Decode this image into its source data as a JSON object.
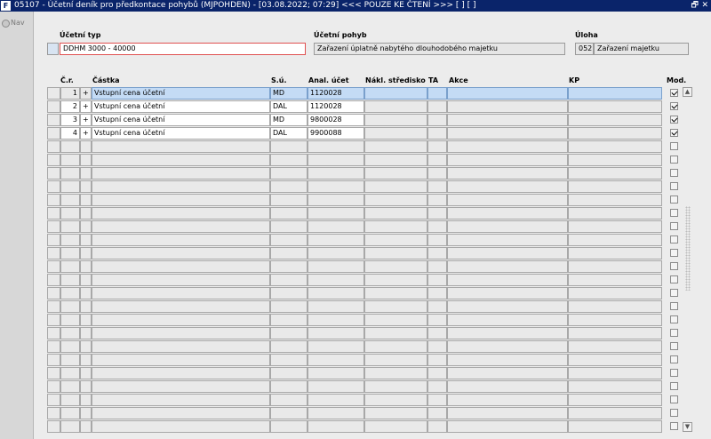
{
  "window": {
    "app_icon_label": "F",
    "title": "05107 - Účetní deník pro předkontace pohybů (MJPOHDEN) - [03.08.2022; 07:29] <<< POUZE KE ČTENÍ >>>  [ ] [ ]",
    "restore_glyph": "🗗",
    "close_glyph": "✕"
  },
  "nav": {
    "label": "Nav"
  },
  "header": {
    "typ_label": "Účetní typ",
    "typ_value": "DDHM 3000 - 40000",
    "pohyb_label": "Účetní pohyb",
    "pohyb_value": "Zařazení úplatně nabytého dlouhodobého majetku",
    "uloha_label": "Úloha",
    "uloha_code": "052",
    "uloha_value": "Zařazení majetku"
  },
  "columns": {
    "cr": "Č.r.",
    "castka": "Částka",
    "su": "S.ú.",
    "anal": "Anal. účet",
    "nakl": "Nákl. středisko",
    "ta": "TA",
    "akce": "Akce",
    "kp": "KP",
    "mod": "Mod."
  },
  "rows": [
    {
      "cr": "1",
      "sign": "+",
      "castka": "Vstupní cena účetní",
      "su": "MD",
      "anal": "1120028",
      "mod": true
    },
    {
      "cr": "2",
      "sign": "+",
      "castka": "Vstupní cena účetní",
      "su": "DAL",
      "anal": "1120028",
      "mod": true
    },
    {
      "cr": "3",
      "sign": "+",
      "castka": "Vstupní cena účetní",
      "su": "MD",
      "anal": "9800028",
      "mod": true
    },
    {
      "cr": "4",
      "sign": "+",
      "castka": "Vstupní cena účetní",
      "su": "DAL",
      "anal": "9900088",
      "mod": true
    }
  ],
  "empty_row_count": 22,
  "scrollbar": {
    "up_glyph": "▲",
    "down_glyph": "▼"
  }
}
